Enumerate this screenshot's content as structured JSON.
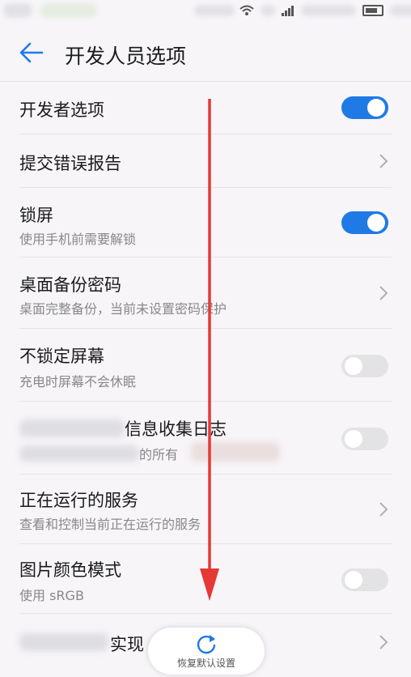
{
  "status_bar": {
    "wifi_icon": "wifi-icon",
    "signal_icon": "signal-icon",
    "battery_icon": "battery-icon"
  },
  "header": {
    "title": "开发人员选项",
    "back_icon": "back-arrow-icon"
  },
  "settings": [
    {
      "title": "开发者选项",
      "subtitle": "",
      "control": "toggle",
      "state": "on"
    },
    {
      "title": "提交错误报告",
      "subtitle": "",
      "control": "chevron"
    },
    {
      "title": "锁屏",
      "subtitle": "使用手机前需要解锁",
      "control": "toggle",
      "state": "on"
    },
    {
      "title": "桌面备份密码",
      "subtitle": "桌面完整备份，当前未设置密码保护",
      "control": "chevron"
    },
    {
      "title": "不锁定屏幕",
      "subtitle": "充电时屏幕不会休眠",
      "control": "toggle",
      "state": "off"
    },
    {
      "title": "信息收集日志",
      "subtitle": "的所有",
      "control": "toggle",
      "state": "off"
    },
    {
      "title": "正在运行的服务",
      "subtitle": "查看和控制当前正在运行的服务",
      "control": "chevron"
    },
    {
      "title": "图片颜色模式",
      "subtitle": "使用 sRGB",
      "control": "toggle",
      "state": "off"
    },
    {
      "title": "实现",
      "subtitle": "",
      "control": "chevron"
    }
  ],
  "restore_button": {
    "label": "恢复默认设置",
    "icon": "refresh-icon"
  },
  "colors": {
    "accent": "#1f7ae6",
    "overlay_arrow": "#e53935"
  }
}
